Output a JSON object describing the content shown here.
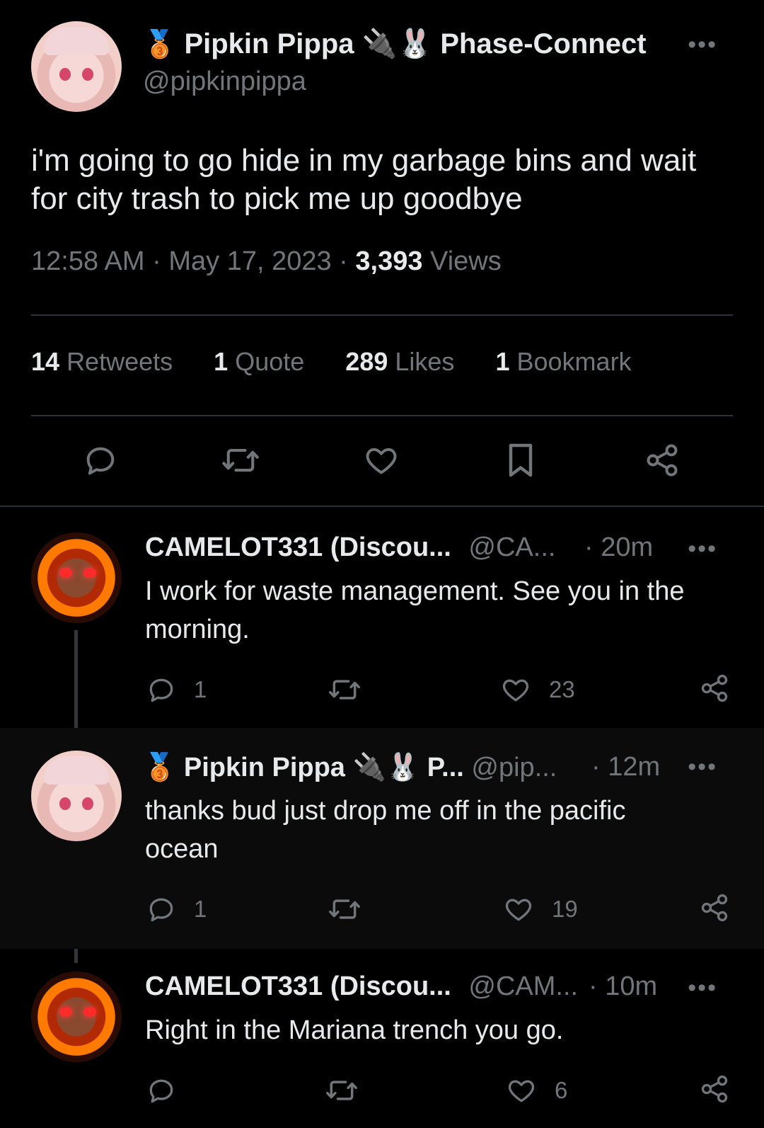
{
  "main_tweet": {
    "author_name": "Pipkin Pippa",
    "badge_emoji": "🥉",
    "plug_emoji": "🔌",
    "rabbit_emoji": "🐰",
    "affiliation": "Phase-Connect",
    "handle": "@pipkinpippa",
    "text_line1": "i'm going to go hide in my garbage bins and wait",
    "text_line2": "for city trash to pick me up goodbye",
    "time": "12:58 AM",
    "date": "May 17, 2023",
    "views_count": "3,393",
    "views_label": "Views",
    "stats": {
      "retweets_count": "14",
      "retweets_label": "Retweets",
      "quote_count": "1",
      "quote_label": "Quote",
      "likes_count": "289",
      "likes_label": "Likes",
      "bookmark_count": "1",
      "bookmark_label": "Bookmark"
    }
  },
  "replies": [
    {
      "author_name": "CAMELOT331 (Discou...",
      "handle": "@CA...",
      "time": "· 20m",
      "text_line1": "I work for waste management. See you in the",
      "text_line2": "morning.",
      "reply_count": "1",
      "like_count": "23"
    },
    {
      "author_name": "Pipkin Pippa",
      "badge_emoji": "🥉",
      "plug_emoji": "🔌",
      "rabbit_emoji": "🐰",
      "affiliation_short": "P...",
      "handle": "@pip...",
      "time": "· 12m",
      "text_line1": "thanks bud just drop me off in the pacific",
      "text_line2": "ocean",
      "reply_count": "1",
      "like_count": "19"
    },
    {
      "author_name": "CAMELOT331 (Discou...",
      "handle": "@CAM...",
      "time": "· 10m",
      "text_line1": "Right in the Mariana trench you go.",
      "like_count": "6"
    }
  ],
  "menu_dots": "•••",
  "colors": {
    "background": "#000000",
    "text": "#e7e9ea",
    "muted": "#71767b",
    "divider": "#2f3336",
    "highlight_row": "#0b0b0b"
  }
}
